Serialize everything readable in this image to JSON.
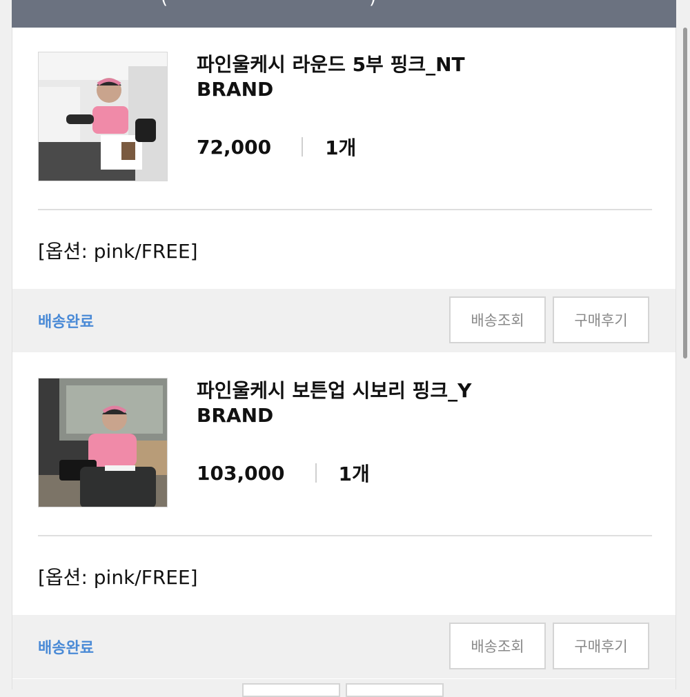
{
  "header": {
    "fragments": [
      "(",
      ")"
    ]
  },
  "orders": [
    {
      "title_line1": "파인울케시 라운드 5부 핑크_NT",
      "title_line2": "BRAND",
      "price": "72,000",
      "quantity": "1개",
      "option": "[옵션: pink/FREE]",
      "status": "배송완료",
      "track_label": "배송조회",
      "review_label": "구매후기"
    },
    {
      "title_line1": "파인울케시 보튼업 시보리 핑크_Y",
      "title_line2": "BRAND",
      "price": "103,000",
      "quantity": "1개",
      "option": "[옵션: pink/FREE]",
      "status": "배송완료",
      "track_label": "배송조회",
      "review_label": "구매후기"
    }
  ],
  "colors": {
    "header": "#6b7280",
    "status": "#4a8ad6",
    "accent_pink": "#f08aa8"
  },
  "icons": [
    "product-photo-1",
    "product-photo-2"
  ]
}
